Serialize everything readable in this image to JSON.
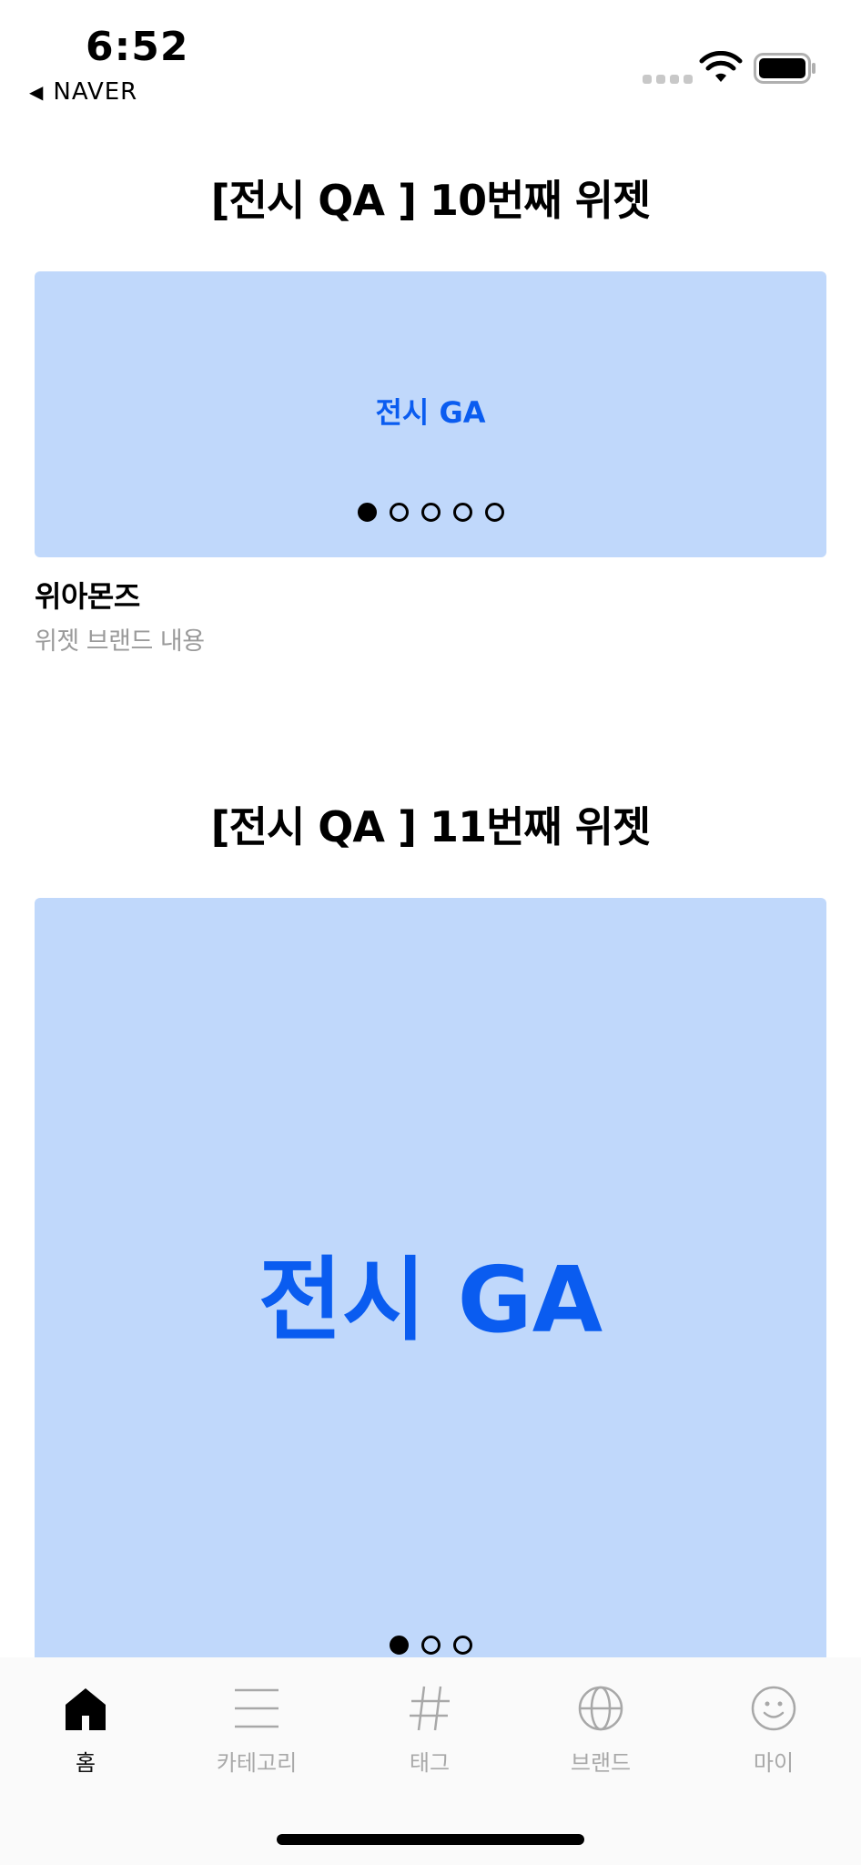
{
  "status_bar": {
    "time": "6:52",
    "back_app": "NAVER",
    "back_icon": "back-triangle-icon"
  },
  "widgets": [
    {
      "title": "[전시 QA ] 10번째 위젯",
      "banner_text": "전시 GA",
      "banner_color": "#c0d8fb",
      "text_color": "#0a5cf0",
      "page_count": 5,
      "active_page": 1,
      "brand_name": "위아몬즈",
      "brand_desc": "위젯 브랜드 내용"
    },
    {
      "title": "[전시 QA ] 11번째 위젯",
      "banner_text": "전시 GA",
      "banner_color": "#c0d8fb",
      "text_color": "#0a5cf0",
      "page_count": 3,
      "active_page": 1
    }
  ],
  "tab_bar": {
    "tabs": [
      {
        "label": "홈",
        "icon": "home-icon",
        "active": true
      },
      {
        "label": "카테고리",
        "icon": "menu-lines-icon",
        "active": false
      },
      {
        "label": "태그",
        "icon": "hashtag-icon",
        "active": false
      },
      {
        "label": "브랜드",
        "icon": "globe-icon",
        "active": false
      },
      {
        "label": "마이",
        "icon": "smiley-icon",
        "active": false
      }
    ]
  }
}
